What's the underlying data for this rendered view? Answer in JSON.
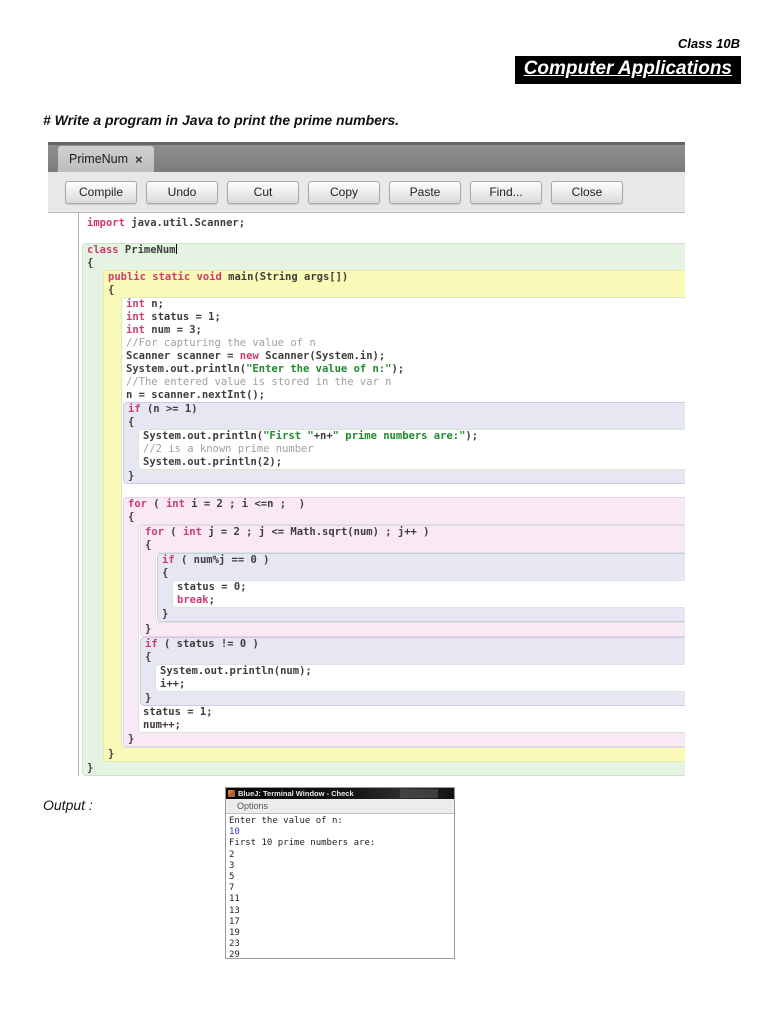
{
  "page": {
    "class_label": "Class 10B",
    "subject": "Computer Applications",
    "question": "# Write a program in Java to print the prime numbers.",
    "output_label": "Output :"
  },
  "editor": {
    "tab": {
      "title": "PrimeNum",
      "close": "×"
    },
    "toolbar": [
      "Compile",
      "Undo",
      "Cut",
      "Copy",
      "Paste",
      "Find...",
      "Close"
    ]
  },
  "colors": {
    "kw": "#ce3a70",
    "str": "#1e8b2e",
    "com": "#a0a0a0",
    "code": "#3e3e3e",
    "sc-green-bg": "#e4f3e2",
    "sc-green-bd": "#c9e5c5",
    "sc-yellow-bg": "#f9f9b8",
    "sc-yellow-bd": "#e9e9a2",
    "sc-lav-bg": "#e7e7f4",
    "sc-lav-bd": "#cacae5",
    "sc-pink-bg": "#f9e9f4",
    "sc-pink-bd": "#edd0e5",
    "sc-white-bd": "#d6e8d4",
    "term-blue": "#2b35c8",
    "banner-bg": "#000000",
    "banner-fg": "#ffffff"
  },
  "code_tree": {
    "box": "none",
    "ch": [
      {
        "segs": [
          [
            "k",
            "import"
          ],
          [
            "p",
            " java.util.Scanner;"
          ]
        ]
      },
      {
        "segs": []
      },
      {
        "box": "green",
        "ch": [
          {
            "segs": [
              [
                "k",
                "class"
              ],
              [
                "p",
                " PrimeNum"
              ],
              [
                "cur",
                ""
              ]
            ]
          },
          {
            "segs": [
              [
                "p",
                "{"
              ]
            ]
          },
          {
            "box": "yellow",
            "ch": [
              {
                "segs": [
                  [
                    "k",
                    "public"
                  ],
                  [
                    "p",
                    " "
                  ],
                  [
                    "k",
                    "static"
                  ],
                  [
                    "p",
                    " "
                  ],
                  [
                    "k",
                    "void"
                  ],
                  [
                    "p",
                    " main(String args[])"
                  ]
                ]
              },
              {
                "segs": [
                  [
                    "p",
                    "{"
                  ]
                ]
              },
              {
                "box": "wbody",
                "ch": [
                  {
                    "segs": [
                      [
                        "k",
                        "int"
                      ],
                      [
                        "p",
                        " n;"
                      ]
                    ]
                  },
                  {
                    "segs": [
                      [
                        "k",
                        "int"
                      ],
                      [
                        "p",
                        " status = 1;"
                      ]
                    ]
                  },
                  {
                    "segs": [
                      [
                        "k",
                        "int"
                      ],
                      [
                        "p",
                        " num = 3;"
                      ]
                    ]
                  },
                  {
                    "segs": [
                      [
                        "c",
                        "//For capturing the value of n"
                      ]
                    ]
                  },
                  {
                    "segs": [
                      [
                        "p",
                        "Scanner scanner = "
                      ],
                      [
                        "k",
                        "new"
                      ],
                      [
                        "p",
                        " Scanner(System.in);"
                      ]
                    ]
                  },
                  {
                    "segs": [
                      [
                        "p",
                        "System.out.println("
                      ],
                      [
                        "s",
                        "\"Enter the value of n:\""
                      ],
                      [
                        "p",
                        ");"
                      ]
                    ]
                  },
                  {
                    "segs": [
                      [
                        "c",
                        "//The entered value is stored in the var n"
                      ]
                    ]
                  },
                  {
                    "segs": [
                      [
                        "p",
                        "n = scanner.nextInt();"
                      ]
                    ]
                  },
                  {
                    "box": "lav",
                    "ch": [
                      {
                        "segs": [
                          [
                            "k",
                            "if"
                          ],
                          [
                            "p",
                            " (n >= 1)"
                          ]
                        ]
                      },
                      {
                        "segs": [
                          [
                            "p",
                            "{"
                          ]
                        ]
                      },
                      {
                        "box": "white",
                        "ch": [
                          {
                            "segs": [
                              [
                                "p",
                                "System.out.println("
                              ],
                              [
                                "s",
                                "\"First \""
                              ],
                              [
                                "p",
                                "+n+"
                              ],
                              [
                                "s",
                                "\" prime numbers are:\""
                              ],
                              [
                                "p",
                                ");"
                              ]
                            ]
                          },
                          {
                            "segs": [
                              [
                                "c",
                                "//2 is a known prime number"
                              ]
                            ]
                          },
                          {
                            "segs": [
                              [
                                "p",
                                "System.out.println(2);"
                              ]
                            ]
                          }
                        ]
                      },
                      {
                        "segs": [
                          [
                            "p",
                            "}"
                          ]
                        ]
                      }
                    ]
                  },
                  {
                    "segs": []
                  },
                  {
                    "box": "pink",
                    "ch": [
                      {
                        "segs": [
                          [
                            "k",
                            "for"
                          ],
                          [
                            "p",
                            " ( "
                          ],
                          [
                            "k",
                            "int"
                          ],
                          [
                            "p",
                            " i = 2 ; i <=n ;  )"
                          ]
                        ]
                      },
                      {
                        "segs": [
                          [
                            "p",
                            "{"
                          ]
                        ]
                      },
                      {
                        "box": "white",
                        "ch": [
                          {
                            "box": "pink",
                            "ch": [
                              {
                                "segs": [
                                  [
                                    "k",
                                    "for"
                                  ],
                                  [
                                    "p",
                                    " ( "
                                  ],
                                  [
                                    "k",
                                    "int"
                                  ],
                                  [
                                    "p",
                                    " j = 2 ; j <= Math.sqrt(num) ; j++ )"
                                  ]
                                ]
                              },
                              {
                                "segs": [
                                  [
                                    "p",
                                    "{"
                                  ]
                                ]
                              },
                              {
                                "box": "white",
                                "ch": [
                                  {
                                    "box": "lav",
                                    "ch": [
                                      {
                                        "segs": [
                                          [
                                            "k",
                                            "if"
                                          ],
                                          [
                                            "p",
                                            " ( num%j == 0 )"
                                          ]
                                        ]
                                      },
                                      {
                                        "segs": [
                                          [
                                            "p",
                                            "{"
                                          ]
                                        ]
                                      },
                                      {
                                        "box": "white",
                                        "ch": [
                                          {
                                            "segs": [
                                              [
                                                "p",
                                                "status = 0;"
                                              ]
                                            ]
                                          },
                                          {
                                            "segs": [
                                              [
                                                "k",
                                                "break"
                                              ],
                                              [
                                                "p",
                                                ";"
                                              ]
                                            ]
                                          }
                                        ]
                                      },
                                      {
                                        "segs": [
                                          [
                                            "p",
                                            "}"
                                          ]
                                        ]
                                      }
                                    ]
                                  }
                                ]
                              },
                              {
                                "segs": [
                                  [
                                    "p",
                                    "}"
                                  ]
                                ]
                              }
                            ]
                          },
                          {
                            "box": "lav",
                            "ch": [
                              {
                                "segs": [
                                  [
                                    "k",
                                    "if"
                                  ],
                                  [
                                    "p",
                                    " ( status != 0 )"
                                  ]
                                ]
                              },
                              {
                                "segs": [
                                  [
                                    "p",
                                    "{"
                                  ]
                                ]
                              },
                              {
                                "box": "white",
                                "ch": [
                                  {
                                    "segs": [
                                      [
                                        "p",
                                        "System.out.println(num);"
                                      ]
                                    ]
                                  },
                                  {
                                    "segs": [
                                      [
                                        "p",
                                        "i++;"
                                      ]
                                    ]
                                  }
                                ]
                              },
                              {
                                "segs": [
                                  [
                                    "p",
                                    "}"
                                  ]
                                ]
                              }
                            ]
                          },
                          {
                            "segs": [
                              [
                                "p",
                                "status = 1;"
                              ]
                            ]
                          },
                          {
                            "segs": [
                              [
                                "p",
                                "num++;"
                              ]
                            ]
                          }
                        ]
                      },
                      {
                        "segs": [
                          [
                            "p",
                            "}"
                          ]
                        ]
                      }
                    ]
                  }
                ]
              },
              {
                "segs": [
                  [
                    "p",
                    "}"
                  ]
                ]
              }
            ]
          },
          {
            "segs": [
              [
                "p",
                "}"
              ]
            ]
          }
        ]
      }
    ]
  },
  "terminal": {
    "title": "BlueJ: Terminal Window - Check",
    "menu": "Options",
    "lines": [
      {
        "t": "Enter the value of n:"
      },
      {
        "t": "10",
        "c": "blue"
      },
      {
        "t": "First 10 prime numbers are:"
      },
      {
        "t": "2"
      },
      {
        "t": "3"
      },
      {
        "t": "5"
      },
      {
        "t": "7"
      },
      {
        "t": "11"
      },
      {
        "t": "13"
      },
      {
        "t": "17"
      },
      {
        "t": "19"
      },
      {
        "t": "23"
      },
      {
        "t": "29"
      }
    ]
  }
}
